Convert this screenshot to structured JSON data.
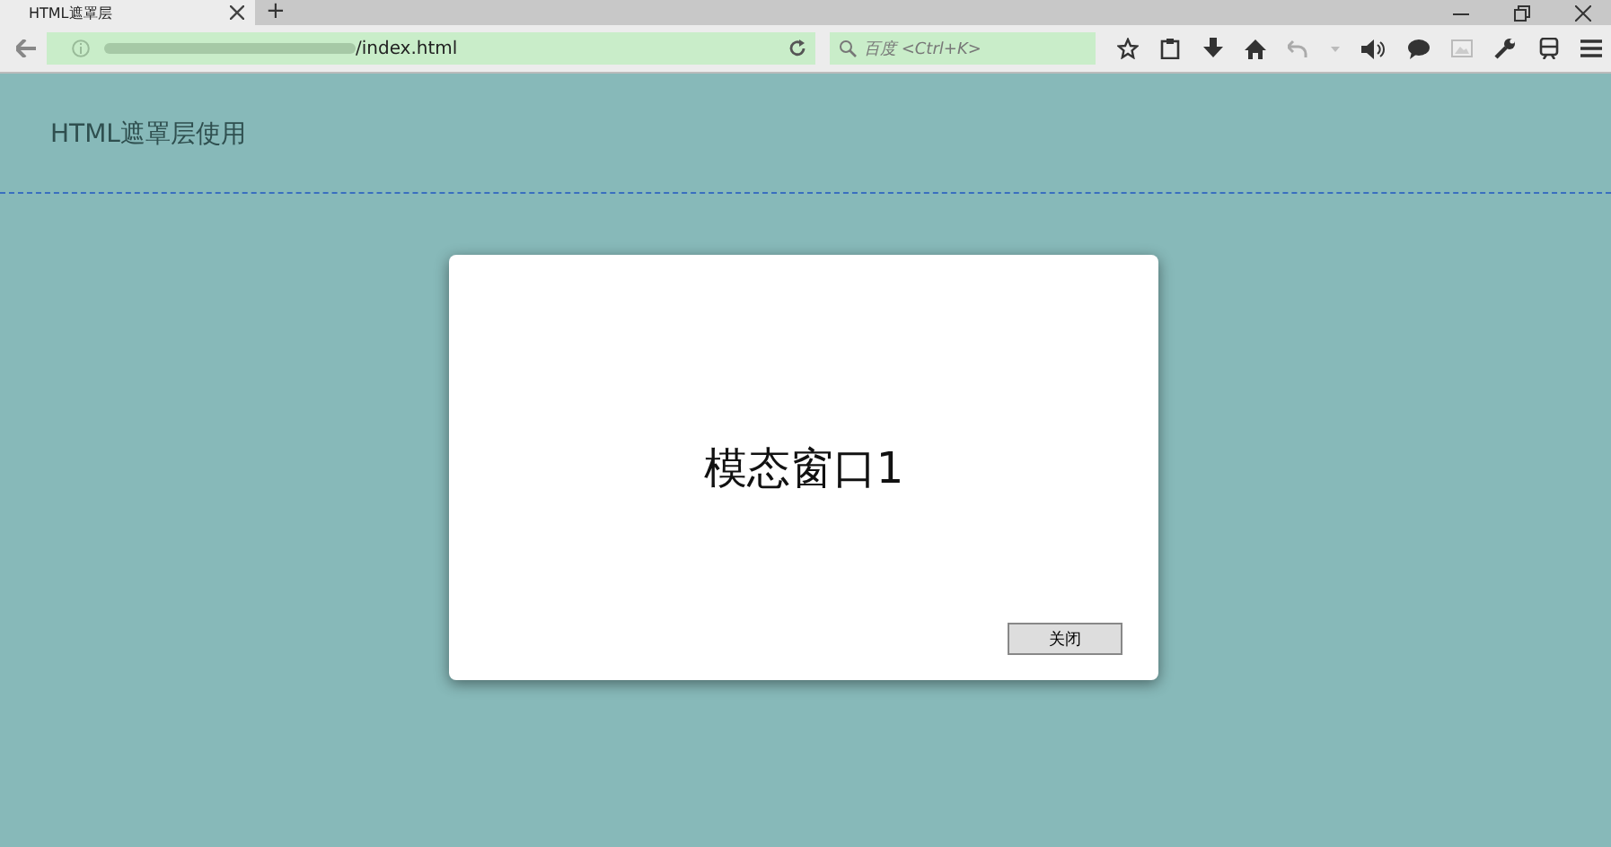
{
  "browser": {
    "tab": {
      "title": "HTML遮罩层",
      "selected": true
    },
    "new_tab": "+",
    "address": "/index.html",
    "search_placeholder": "百度 <Ctrl+K>"
  },
  "page": {
    "heading": "HTML遮罩层使用"
  },
  "modal": {
    "title": "模态窗口1",
    "close_button": "关闭"
  }
}
